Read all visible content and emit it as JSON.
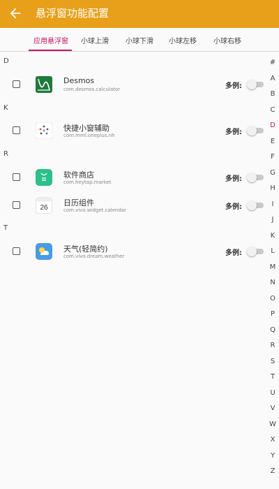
{
  "app_bar": {
    "title": "悬浮窗功能配置",
    "back_icon": "arrow-left-icon",
    "color": "#e8a01a"
  },
  "tabs": [
    {
      "label": "应用悬浮窗",
      "active": true
    },
    {
      "label": "小球上滑",
      "active": false
    },
    {
      "label": "小球下滑",
      "active": false
    },
    {
      "label": "小球左移",
      "active": false
    },
    {
      "label": "小球右移",
      "active": false
    }
  ],
  "accent_color": "#c2185b",
  "sections": [
    {
      "letter": "D",
      "apps": [
        {
          "name": "Desmos",
          "package": "com.desmos.calculator",
          "icon": "desmos-icon",
          "checked": false,
          "multi_label": "多例:",
          "multi_enabled": false
        }
      ]
    },
    {
      "letter": "K",
      "apps": [
        {
          "name": "快捷小窗辅助",
          "package": "com.mml.oneplus.nh",
          "icon": "quick-window-icon",
          "checked": false,
          "multi_label": "多例:",
          "multi_enabled": false
        }
      ]
    },
    {
      "letter": "R",
      "apps": [
        {
          "name": "软件商店",
          "package": "com.heytap.market",
          "icon": "app-store-icon",
          "checked": false,
          "multi_label": "多例:",
          "multi_enabled": false
        },
        {
          "name": "日历组件",
          "package": "com.vivo.widget.calendar",
          "icon": "calendar-icon",
          "calendar_day": "26",
          "checked": false,
          "multi_label": "多例:",
          "multi_enabled": false
        }
      ]
    },
    {
      "letter": "T",
      "apps": [
        {
          "name": "天气(轻简约)",
          "package": "com.vivo.dream.weather",
          "icon": "weather-icon",
          "checked": false,
          "multi_label": "多例:",
          "multi_enabled": false
        }
      ]
    }
  ],
  "index_bar": {
    "letters": [
      "#",
      "A",
      "B",
      "C",
      "D",
      "E",
      "F",
      "G",
      "H",
      "I",
      "J",
      "K",
      "L",
      "M",
      "N",
      "O",
      "P",
      "Q",
      "R",
      "S",
      "T",
      "U",
      "V",
      "W",
      "X",
      "Y",
      "Z"
    ],
    "active": "D"
  }
}
